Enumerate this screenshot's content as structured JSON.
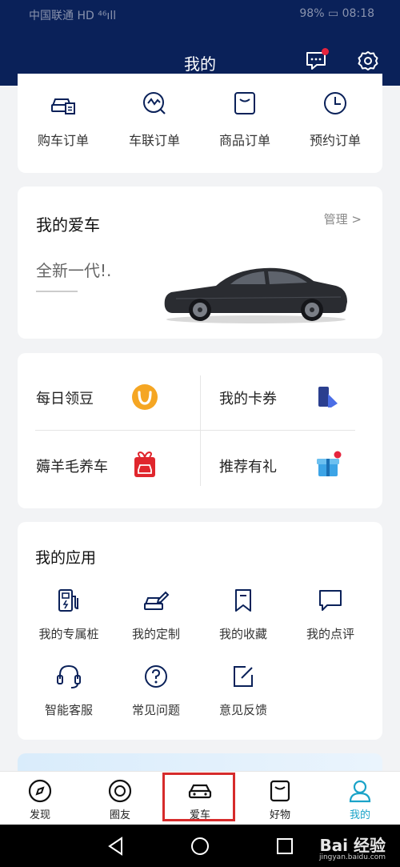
{
  "status_bar": {
    "carrier": "中国联通 HD ⁴⁶ıll",
    "battery": "98%",
    "time": "08:18"
  },
  "header": {
    "title": "我的"
  },
  "orders": [
    {
      "label": "购车订单",
      "icon": "car-order-icon"
    },
    {
      "label": "车联订单",
      "icon": "connected-order-icon"
    },
    {
      "label": "商品订单",
      "icon": "product-order-icon"
    },
    {
      "label": "预约订单",
      "icon": "clock-icon"
    }
  ],
  "my_car": {
    "title": "我的爱车",
    "manage": "管理 >",
    "model": "全新一代!."
  },
  "services": [
    {
      "label": "每日领豆",
      "icon": "bean-icon"
    },
    {
      "label": "我的卡券",
      "icon": "coupon-icon"
    },
    {
      "label": "薅羊毛养车",
      "icon": "gift-car-icon"
    },
    {
      "label": "推荐有礼",
      "icon": "gift-icon"
    }
  ],
  "apps": {
    "title": "我的应用",
    "items": [
      {
        "label": "我的专属桩",
        "icon": "charging-pile-icon"
      },
      {
        "label": "我的定制",
        "icon": "customize-car-icon"
      },
      {
        "label": "我的收藏",
        "icon": "bookmark-icon"
      },
      {
        "label": "我的点评",
        "icon": "comment-icon"
      },
      {
        "label": "智能客服",
        "icon": "headset-icon"
      },
      {
        "label": "常见问题",
        "icon": "question-icon"
      },
      {
        "label": "意见反馈",
        "icon": "feedback-icon"
      }
    ]
  },
  "tabs": [
    {
      "label": "发现",
      "icon": "compass-icon"
    },
    {
      "label": "圈友",
      "icon": "circle-icon"
    },
    {
      "label": "爱车",
      "icon": "car-icon"
    },
    {
      "label": "好物",
      "icon": "shop-icon"
    },
    {
      "label": "我的",
      "icon": "user-icon",
      "active": true
    }
  ],
  "watermark": {
    "logo": "Bai 经验",
    "url": "jingyan.baidu.com"
  },
  "colors": {
    "header": "#0a2159",
    "accent": "#1aa3c8",
    "badge": "#e6243d",
    "highlight": "#d62b2b"
  }
}
